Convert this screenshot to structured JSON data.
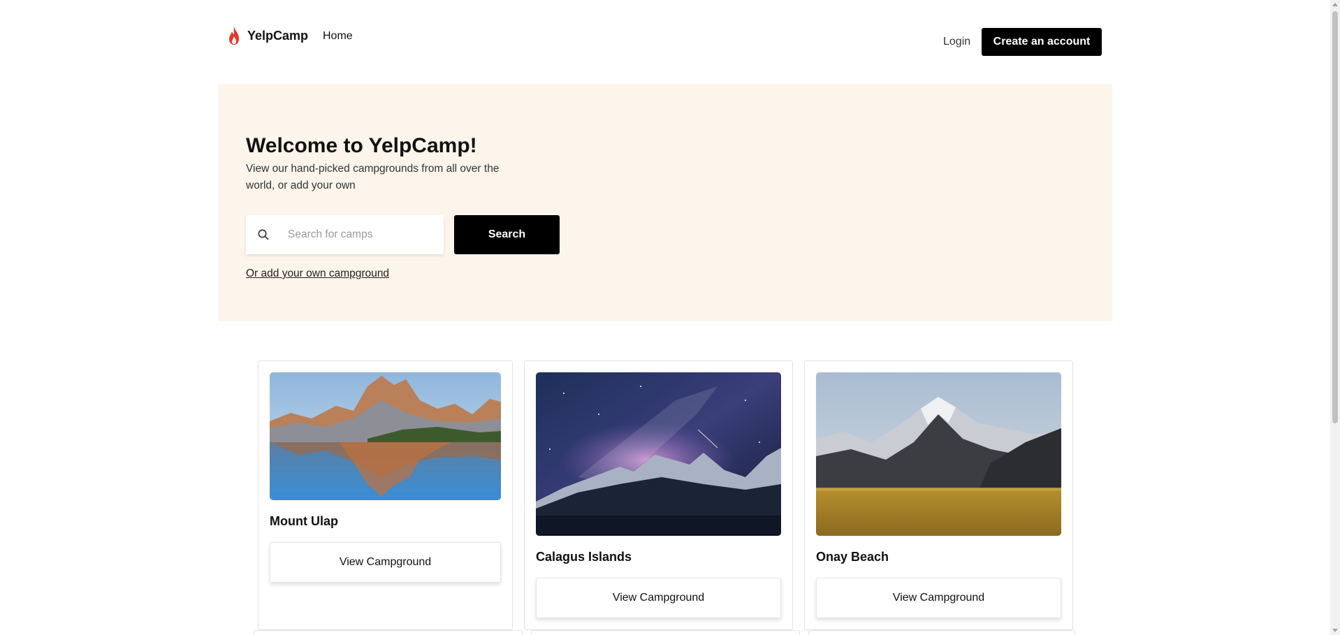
{
  "header": {
    "brand": "YelpCamp",
    "brand_icon": "flame-icon",
    "home": "Home",
    "login": "Login",
    "create_account": "Create an account"
  },
  "hero": {
    "title": "Welcome to YelpCamp!",
    "subtitle": "View our hand-picked campgrounds from all over the world, or add your own",
    "search_placeholder": "Search for camps",
    "search_value": "",
    "search_button": "Search",
    "add_link": "Or add your own campground"
  },
  "campgrounds": [
    {
      "name": "Mount Ulap",
      "button": "View Campground",
      "image": "mountain-lake-reflection-image"
    },
    {
      "name": "Calagus Islands",
      "button": "View Campground",
      "image": "milky-way-mountains-image"
    },
    {
      "name": "Onay Beach",
      "button": "View Campground",
      "image": "snowy-mountain-meadow-image"
    }
  ],
  "colors": {
    "hero_background": "#fdf5ec",
    "primary_button": "#000000",
    "brand_flame": "#e8362a"
  }
}
